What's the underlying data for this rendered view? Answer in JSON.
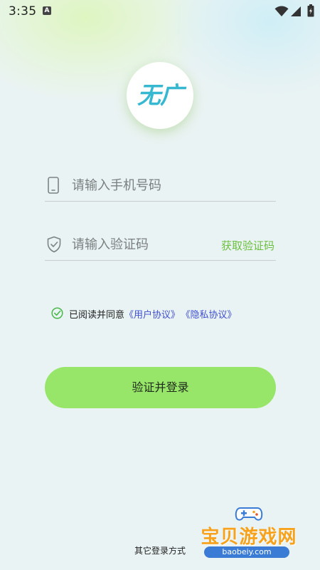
{
  "status_bar": {
    "time": "3:35",
    "notification_badge": "A"
  },
  "logo": {
    "text": "无广"
  },
  "phone_field": {
    "placeholder": "请输入手机号码",
    "value": ""
  },
  "code_field": {
    "placeholder": "请输入验证码",
    "value": "",
    "get_code_label": "获取验证码"
  },
  "agreement": {
    "checked": true,
    "prefix": "已阅读并同意",
    "user_agreement": "《用户协议》",
    "privacy_policy": "《隐私协议》"
  },
  "login_button": {
    "label": "验证并登录"
  },
  "other_login": {
    "label": "其它登录方式"
  },
  "watermark": {
    "text": "宝贝游戏网",
    "url": "baobeiy.com"
  },
  "colors": {
    "background": "#eaf3f3",
    "accent_green": "#97e66a",
    "link_green": "#6cbf3f",
    "link_blue": "#3f4fd0",
    "logo_cyan": "#36b8d0"
  }
}
